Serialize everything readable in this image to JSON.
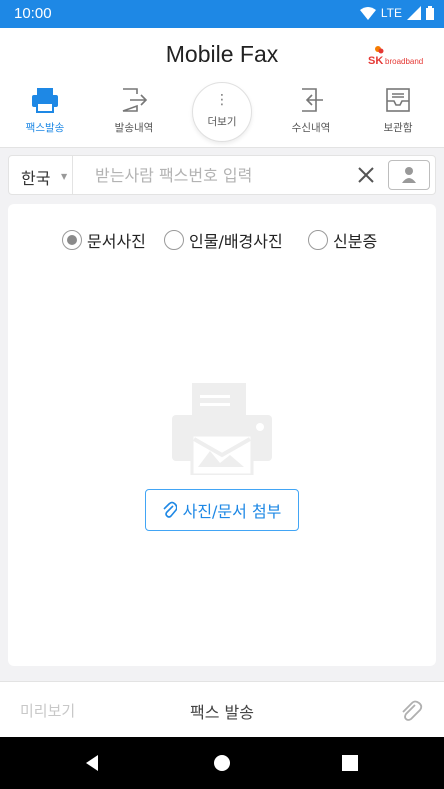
{
  "status_bar": {
    "time": "10:00",
    "network": "LTE"
  },
  "header": {
    "title": "Mobile Fax",
    "brand": "SK broadband"
  },
  "nav": {
    "items": [
      {
        "label": "팩스발송",
        "icon": "printer-icon",
        "active": true
      },
      {
        "label": "발송내역",
        "icon": "sent-history-icon"
      },
      {
        "label": "수신내역",
        "icon": "received-history-icon"
      },
      {
        "label": "보관함",
        "icon": "archive-icon"
      }
    ],
    "more_label": "더보기"
  },
  "recipient": {
    "country": "한국",
    "placeholder": "받는사람 팩스번호 입력",
    "value": ""
  },
  "doc_type": {
    "options": [
      {
        "label": "문서사진",
        "checked": true
      },
      {
        "label": "인물/배경사진",
        "checked": false
      },
      {
        "label": "신분증",
        "checked": false
      }
    ]
  },
  "attach_label": "사진/문서 첨부",
  "bottom": {
    "preview": "미리보기",
    "send": "팩스 발송"
  },
  "colors": {
    "accent": "#1e88e5",
    "status_bar": "#1e88e5",
    "brand_red": "#e53935"
  }
}
